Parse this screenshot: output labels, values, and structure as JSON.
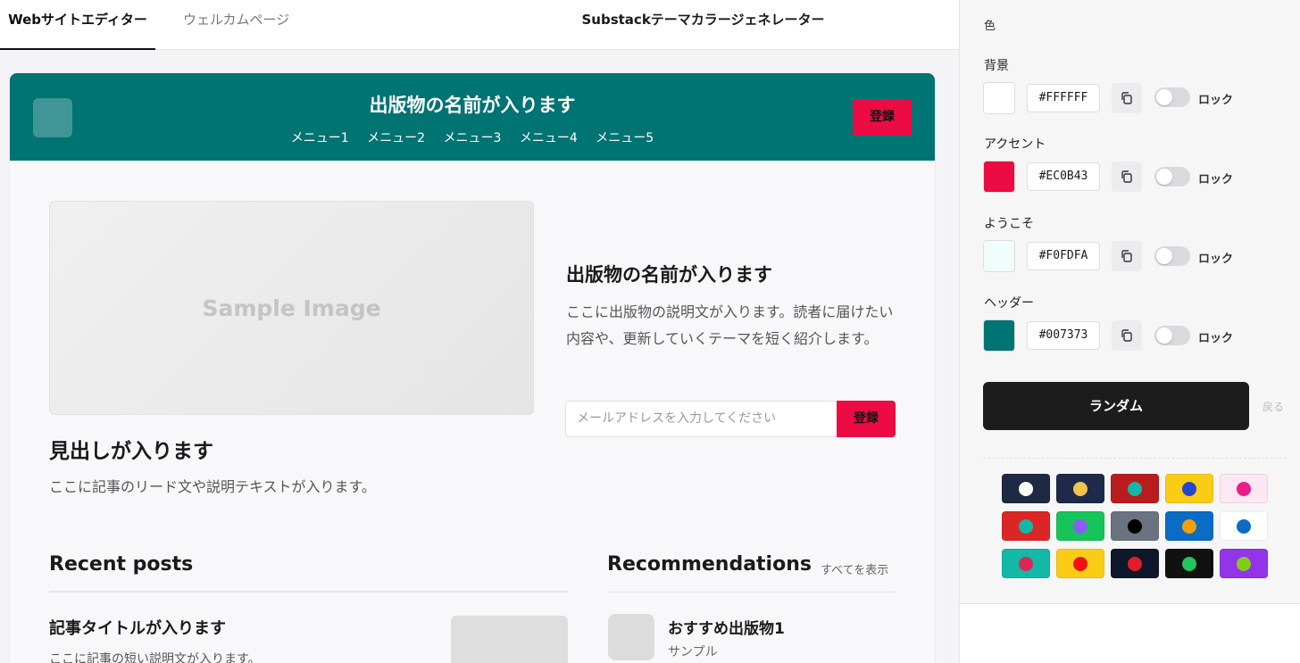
{
  "tabs": [
    {
      "label": "Webサイトエディター",
      "active": true
    },
    {
      "label": "ウェルカムページ",
      "active": false
    }
  ],
  "app_title": "Substackテーマカラージェネレーター",
  "preview": {
    "header": {
      "publication_name": "出版物の名前が入ります",
      "menus": [
        "メニュー1",
        "メニュー2",
        "メニュー3",
        "メニュー4",
        "メニュー5"
      ],
      "subscribe_label": "登録"
    },
    "image_placeholder": "Sample Image",
    "headline": "見出しが入ります",
    "lead": "ここに記事のリード文や説明テキストが入ります。",
    "publication_title": "出版物の名前が入ります",
    "publication_desc": "ここに出版物の説明文が入ります。読者に届けたい内容や、更新していくテーマを短く紹介します。",
    "email_placeholder": "メールアドレスを入力してください",
    "email_button": "登録",
    "recent_posts": {
      "heading": "Recent posts",
      "post_title": "記事タイトルが入ります",
      "post_desc": "ここに記事の短い説明文が入ります。"
    },
    "recommendations": {
      "heading": "Recommendations",
      "see_all": "すべてを表示",
      "item_name": "おすすめ出版物1",
      "item_sub": "サンプル"
    }
  },
  "panel": {
    "section_label": "色",
    "colors": [
      {
        "label": "背景",
        "hex": "#FFFFFF",
        "lock": "ロック"
      },
      {
        "label": "アクセント",
        "hex": "#EC0B43",
        "lock": "ロック"
      },
      {
        "label": "ようこそ",
        "hex": "#F0FDFA",
        "lock": "ロック"
      },
      {
        "label": "ヘッダー",
        "hex": "#007373",
        "lock": "ロック"
      }
    ],
    "random_label": "ランダム",
    "back_label": "戻る",
    "presets": [
      {
        "bg": "#1E2A44",
        "dot": "#FFFFFF"
      },
      {
        "bg": "#1E2A4A",
        "dot": "#F2C14E"
      },
      {
        "bg": "#B91C1C",
        "dot": "#14B8A6"
      },
      {
        "bg": "#FACC15",
        "dot": "#2545D0"
      },
      {
        "bg": "#FCE7F3",
        "dot": "#EC1C8B"
      },
      {
        "bg": "#DC2626",
        "dot": "#14B8A6"
      },
      {
        "bg": "#16C45A",
        "dot": "#8B5CF6"
      },
      {
        "bg": "#6B7280",
        "dot": "#000000"
      },
      {
        "bg": "#0A6CC4",
        "dot": "#F59E0B"
      },
      {
        "bg": "#FFFFFF",
        "dot": "#0A6CC4"
      },
      {
        "bg": "#14B8A6",
        "dot": "#DC2656"
      },
      {
        "bg": "#FACC15",
        "dot": "#EF1111"
      },
      {
        "bg": "#0F172A",
        "dot": "#E11D2A"
      },
      {
        "bg": "#111111",
        "dot": "#22C55E"
      },
      {
        "bg": "#9333EA",
        "dot": "#84CC16"
      }
    ]
  }
}
